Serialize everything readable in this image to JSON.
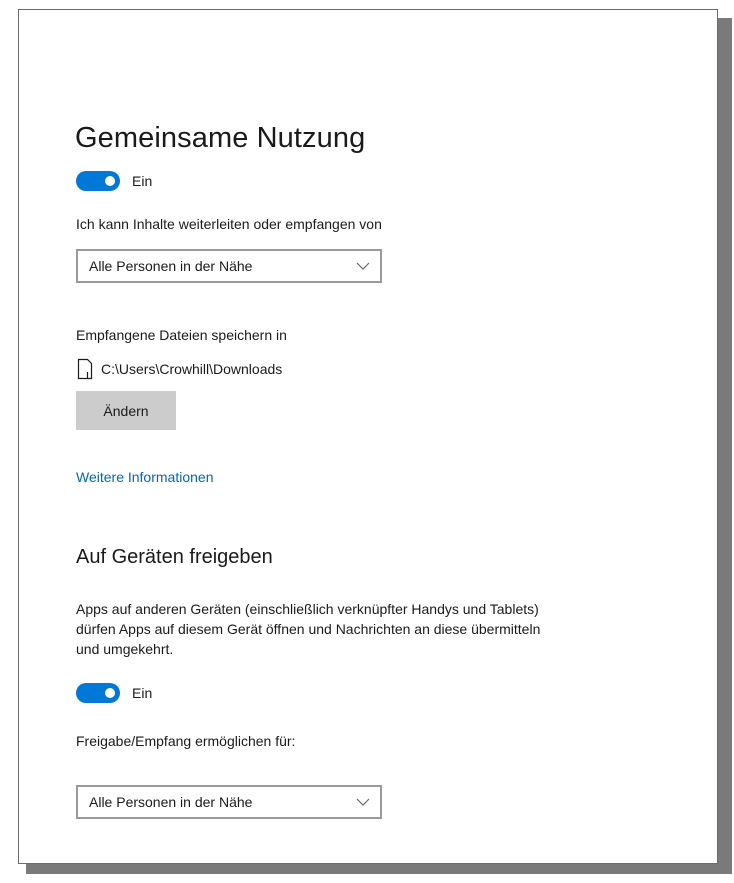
{
  "colors": {
    "accent": "#0078d7",
    "link": "#0067b8",
    "button_bg": "#cccccc",
    "dropdown_border": "#9a9a9a"
  },
  "sharing": {
    "title": "Gemeinsame Nutzung",
    "toggle": {
      "state": "on",
      "label": "Ein"
    },
    "receive_from_label": "Ich kann Inhalte weiterleiten oder empfangen von",
    "receive_from_dropdown": {
      "selected": "Alle Personen in der Nähe",
      "icon": "chevron-down-icon"
    },
    "save_location_label": "Empfangene Dateien speichern in",
    "save_location_icon": "file-icon",
    "save_location_path": "C:\\Users\\Crowhill\\Downloads",
    "change_button": "Ändern",
    "more_info_link": "Weitere Informationen"
  },
  "cross_device": {
    "title": "Auf Geräten freigeben",
    "description": "Apps auf anderen Geräten (einschließlich verknüpfter Handys und Tablets) dürfen Apps auf diesem Gerät öffnen und Nachrichten an diese übermitteln und umgekehrt.",
    "toggle": {
      "state": "on",
      "label": "Ein"
    },
    "enable_for_label": "Freigabe/Empfang ermöglichen für:",
    "enable_for_dropdown": {
      "selected": "Alle Personen in der Nähe",
      "icon": "chevron-down-icon"
    }
  }
}
